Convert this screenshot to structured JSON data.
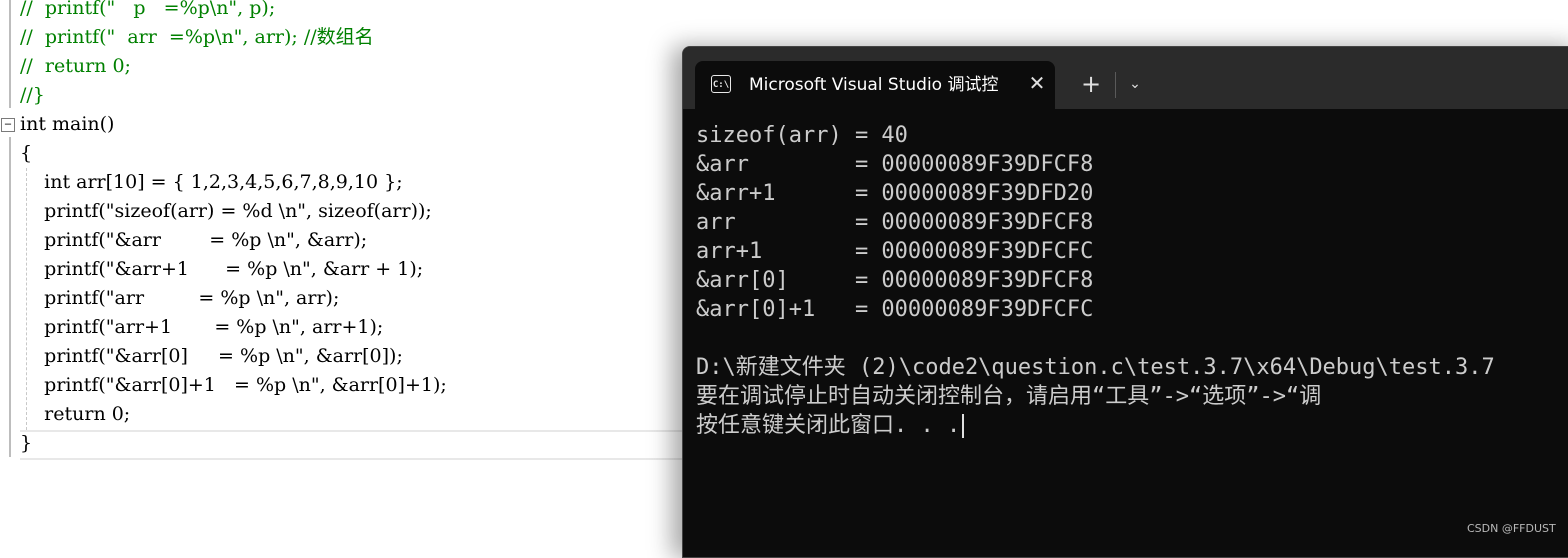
{
  "editor": {
    "lines": [
      "//  printf(\"   p   =%p\\n\", p);",
      "//  printf(\"  arr  =%p\\n\", arr); //数组名",
      "//  return 0;",
      "//}",
      "int main()",
      "{",
      "    int arr[10] = { 1,2,3,4,5,6,7,8,9,10 };",
      "    printf(\"sizeof(arr) = %d \\n\", sizeof(arr));",
      "    printf(\"&arr        = %p \\n\", &arr);",
      "    printf(\"&arr+1      = %p \\n\", &arr + 1);",
      "    printf(\"arr         = %p \\n\", arr);",
      "    printf(\"arr+1       = %p \\n\", arr+1);",
      "    printf(\"&arr[0]     = %p \\n\", &arr[0]);",
      "    printf(\"&arr[0]+1   = %p \\n\", &arr[0]+1);",
      "    return 0;",
      "}"
    ],
    "fold_glyph": "−"
  },
  "terminal": {
    "tab_title": "Microsoft Visual Studio 调试控制台",
    "tab_icon": "C:\\",
    "close_glyph": "✕",
    "new_tab_glyph": "+",
    "dropdown_glyph": "⌄",
    "output": [
      "sizeof(arr) = 40",
      "&arr        = 00000089F39DFCF8",
      "&arr+1      = 00000089F39DFD20",
      "arr         = 00000089F39DFCF8",
      "arr+1       = 00000089F39DFCFC",
      "&arr[0]     = 00000089F39DFCF8",
      "&arr[0]+1   = 00000089F39DFCFC",
      "",
      "D:\\新建文件夹 (2)\\code2\\question.c\\test.3.7\\x64\\Debug\\test.3.7",
      "要在调试停止时自动关闭控制台，请启用“工具”->“选项”->“调",
      "按任意键关闭此窗口. . ."
    ]
  },
  "watermark": "CSDN @FFDUST",
  "colors": {
    "comment": "#008000",
    "keyword": "#0000ff",
    "string": "#a31515",
    "terminal_bg": "#0c0c0c",
    "titlebar_bg": "#2b2b2b"
  }
}
